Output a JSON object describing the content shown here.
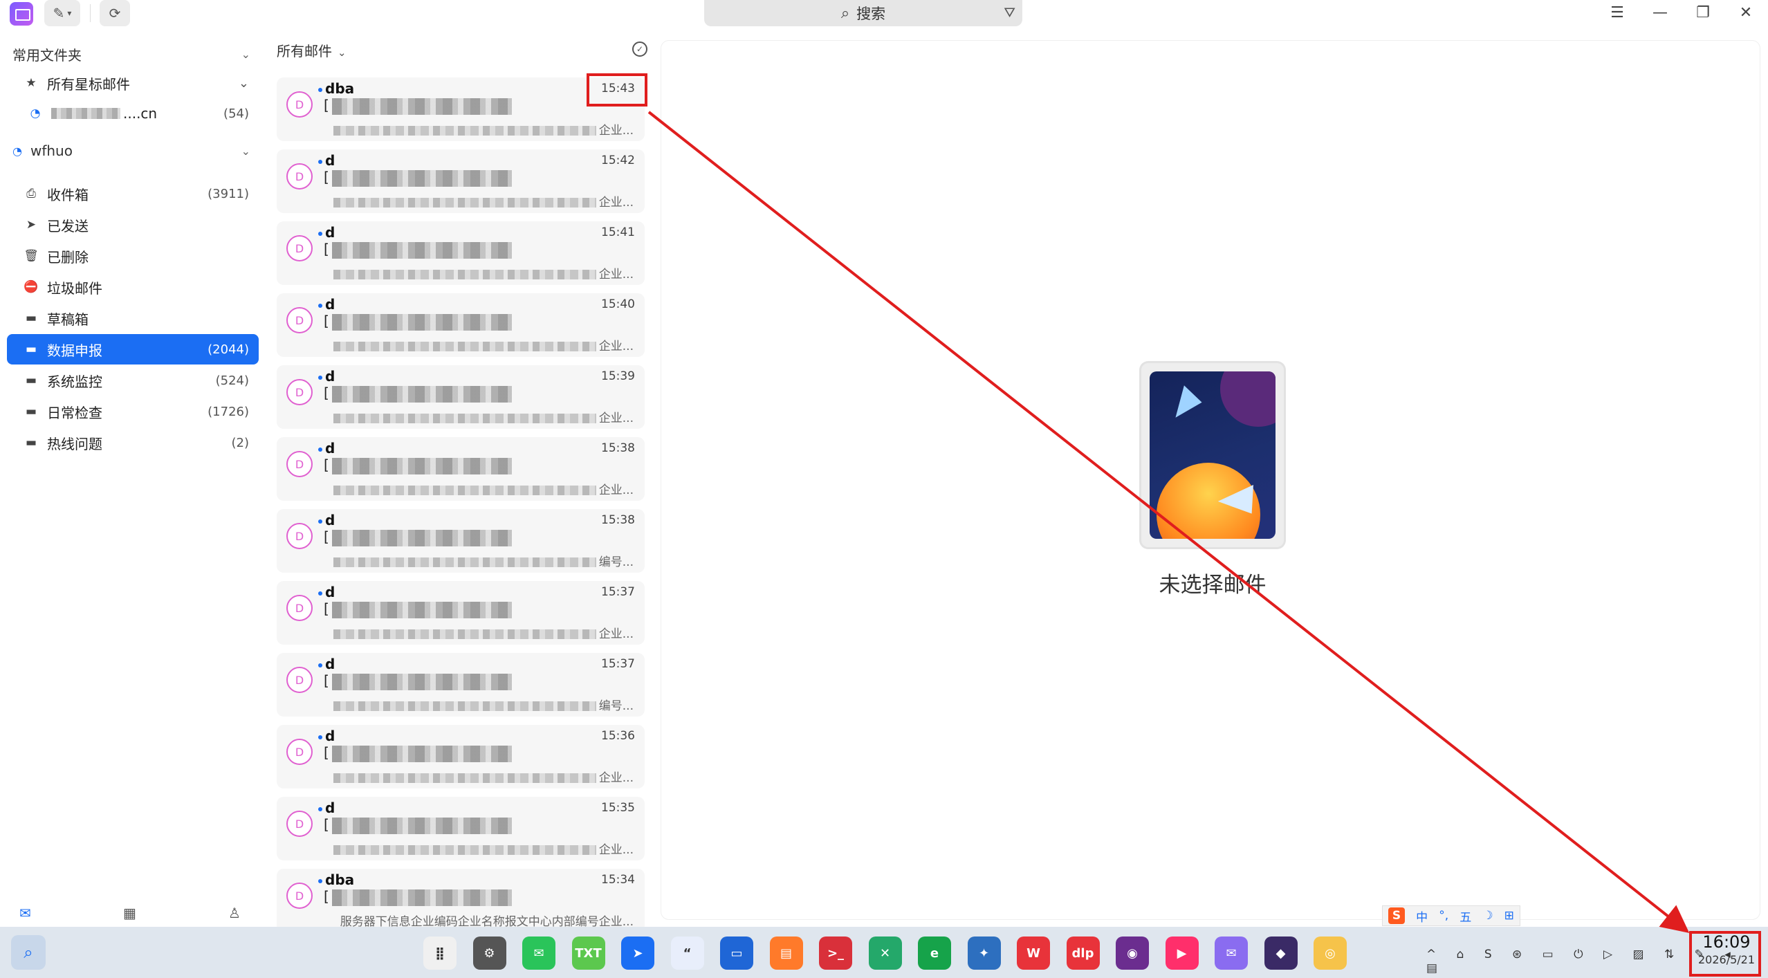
{
  "titlebar": {
    "search_label": "搜索",
    "minimize": "—",
    "maximize": "❐",
    "close": "✕",
    "menu": "☰"
  },
  "sidebar": {
    "favorites_header": "常用文件夹",
    "starred_label": "所有星标邮件",
    "account_alias": "....cn",
    "account_alias_count": "(54)",
    "account_header": "wfhuo",
    "folders": [
      {
        "label": "收件箱",
        "count": "(3911)",
        "icon": "inbox-icon"
      },
      {
        "label": "已发送",
        "count": "",
        "icon": "send-icon"
      },
      {
        "label": "已删除",
        "count": "",
        "icon": "trash-icon"
      },
      {
        "label": "垃圾邮件",
        "count": "",
        "icon": "junk-icon"
      },
      {
        "label": "草稿箱",
        "count": "",
        "icon": "folder-icon"
      },
      {
        "label": "数据申报",
        "count": "(2044)",
        "icon": "folder-icon",
        "active": true
      },
      {
        "label": "系统监控",
        "count": "(524)",
        "icon": "folder-icon"
      },
      {
        "label": "日常检查",
        "count": "(1726)",
        "icon": "folder-icon"
      },
      {
        "label": "热线问题",
        "count": "(2)",
        "icon": "folder-icon"
      }
    ]
  },
  "list": {
    "header": "所有邮件",
    "mails": [
      {
        "avatar": "D",
        "sender": "dba",
        "time": "15:43",
        "bracket": "[",
        "preview_tail": "企业..."
      },
      {
        "avatar": "D",
        "sender": "d",
        "time": "15:42",
        "bracket": "[",
        "preview_tail": "企业..."
      },
      {
        "avatar": "D",
        "sender": "d",
        "time": "15:41",
        "bracket": "[",
        "preview_tail": "企业..."
      },
      {
        "avatar": "D",
        "sender": "d",
        "time": "15:40",
        "bracket": "[",
        "preview_tail": "企业..."
      },
      {
        "avatar": "D",
        "sender": "d",
        "time": "15:39",
        "bracket": "[",
        "preview_tail": "企业..."
      },
      {
        "avatar": "D",
        "sender": "d",
        "time": "15:38",
        "bracket": "[",
        "preview_tail": "企业..."
      },
      {
        "avatar": "D",
        "sender": "d",
        "time": "15:38",
        "bracket": "[",
        "preview_tail": "编号..."
      },
      {
        "avatar": "D",
        "sender": "d",
        "time": "15:37",
        "bracket": "[",
        "preview_tail": "企业..."
      },
      {
        "avatar": "D",
        "sender": "d",
        "time": "15:37",
        "bracket": "[",
        "preview_tail": "编号..."
      },
      {
        "avatar": "D",
        "sender": "d",
        "time": "15:36",
        "bracket": "[",
        "preview_tail": "企业..."
      },
      {
        "avatar": "D",
        "sender": "d",
        "time": "15:35",
        "bracket": "[",
        "preview_tail": "企业..."
      },
      {
        "avatar": "D",
        "sender": "dba",
        "time": "15:34",
        "bracket": "[",
        "preview_tail": "企业..."
      }
    ],
    "last_preview_text": "服务器下信息企业编码企业名称报文中心内部编号企业..."
  },
  "reading": {
    "empty_label": "未选择邮件"
  },
  "ime": {
    "items": [
      "S",
      "中",
      "°,",
      "五",
      "☽",
      "⊞"
    ]
  },
  "taskbar": {
    "clock_time": "16:09",
    "clock_date": "2026/5/21",
    "dock": [
      {
        "name": "launcher-icon",
        "label": "⣿",
        "color": "#f0f0f0"
      },
      {
        "name": "settings-icon",
        "label": "⚙",
        "color": "#555555"
      },
      {
        "name": "wechat-icon",
        "label": "✉",
        "color": "#2ac45a"
      },
      {
        "name": "txt-editor-icon",
        "label": "TXT",
        "color": "#5cc84e"
      },
      {
        "name": "feishu-icon",
        "label": "➤",
        "color": "#1b6ef3"
      },
      {
        "name": "quote-app-icon",
        "label": "“",
        "color": "#e8eefb"
      },
      {
        "name": "file-manager-icon",
        "label": "▭",
        "color": "#1f66d6"
      },
      {
        "name": "app-store-icon",
        "label": "▤",
        "color": "#ff7a2a"
      },
      {
        "name": "terminal-icon",
        "label": ">_",
        "color": "#d9303a"
      },
      {
        "name": "xshell-icon",
        "label": "✕",
        "color": "#24a86a"
      },
      {
        "name": "browser-icon",
        "label": "e",
        "color": "#16a34a"
      },
      {
        "name": "photo-icon",
        "label": "✦",
        "color": "#2d6fbf"
      },
      {
        "name": "wps-icon",
        "label": "W",
        "color": "#e8333a"
      },
      {
        "name": "video-icon",
        "label": "dlp",
        "color": "#e8333a"
      },
      {
        "name": "firefox-icon",
        "label": "◉",
        "color": "#6b2d8f"
      },
      {
        "name": "presenter-icon",
        "label": "▶",
        "color": "#ff2f6b"
      },
      {
        "name": "mail-app-icon",
        "label": "✉",
        "color": "#8a6cf0"
      },
      {
        "name": "crystal-icon",
        "label": "◆",
        "color": "#3a2a66"
      },
      {
        "name": "screenshot-icon",
        "label": "◎",
        "color": "#f6c34a"
      }
    ],
    "tray": "^ ⌂ S ⊛ ▭ ⏻ ▷ ▨ ⇅ ✎ ◂ ▤"
  },
  "colors": {
    "accent": "#1b6ef3",
    "annotation": "#e01e1e"
  }
}
